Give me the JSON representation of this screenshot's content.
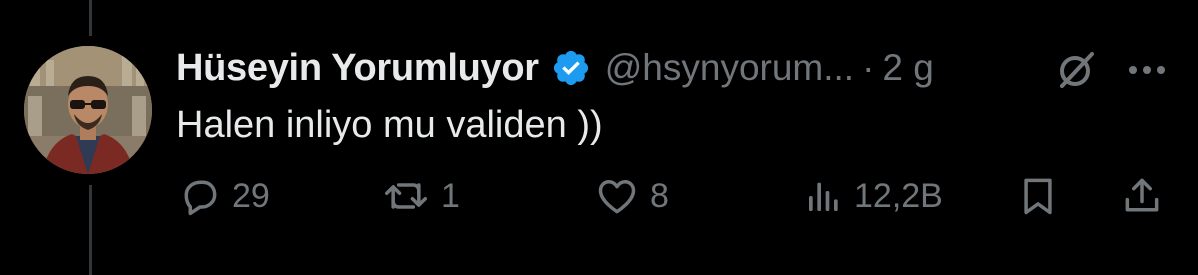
{
  "post": {
    "author": {
      "display_name": "Hüseyin Yorumluyor",
      "handle": "@hsynyorum...",
      "verified": true
    },
    "separator": "·",
    "time": "2 g",
    "text": "Halen inliyo mu validen ))"
  },
  "actions": {
    "reply_count": "29",
    "repost_count": "1",
    "like_count": "8",
    "view_count": "12,2B"
  },
  "icons": {
    "verified": "verified-badge-icon",
    "grok": "grok-icon",
    "more": "more-icon",
    "reply": "reply-icon",
    "repost": "repost-icon",
    "like": "heart-icon",
    "views": "views-icon",
    "bookmark": "bookmark-icon",
    "share": "share-icon"
  },
  "colors": {
    "background": "#000000",
    "text_primary": "#e7e9ea",
    "text_secondary": "#71767b",
    "verified_blue": "#1d9bf0"
  }
}
